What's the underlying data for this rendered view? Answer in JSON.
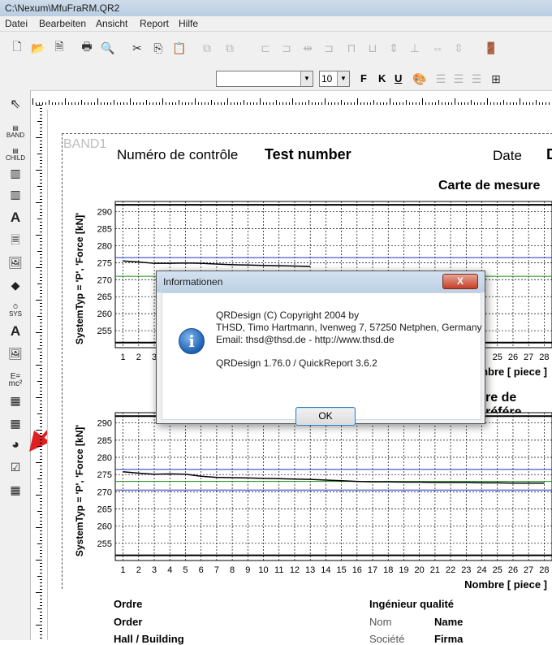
{
  "window": {
    "title": "C:\\Nexum\\MfuFraRM.QR2"
  },
  "menu": [
    "Datei",
    "Bearbeiten",
    "Ansicht",
    "Report",
    "Hilfe"
  ],
  "toolbar": {
    "font_value": "",
    "font_size": "10",
    "bold": "F",
    "italic": "K",
    "underline": "U"
  },
  "tools": [
    "BAND",
    "CHILD",
    "SYS"
  ],
  "report": {
    "band_label": "BAND1",
    "header": {
      "control_number_label": "Numéro de contrôle",
      "test_number": "Test number",
      "date_label": "Date",
      "d_label": "D"
    },
    "chart1": {
      "title": "Carte de mesure",
      "ylabel": "SystemTyp = 'P', 'Force [kN]'",
      "xlabel": "Nombre [ piece ]"
    },
    "chart2": {
      "title": "re de référe",
      "ylabel": "SystemTyp = 'P', 'Force [kN]'",
      "xlabel": "Nombre [ piece ]"
    },
    "footer": {
      "ordre": "Ordre",
      "order": "Order",
      "hall": "Hall / Building",
      "engineer": "Ingénieur qualité",
      "nom": "Nom",
      "name": "Name",
      "societe": "Société",
      "firma": "Firma"
    }
  },
  "chart_data": [
    {
      "type": "line",
      "title": "Carte de mesure",
      "xlabel": "Nombre [ piece ]",
      "ylabel": "SystemTyp = 'P', 'Force [kN]'",
      "x_ticks": [
        1,
        2,
        3,
        25,
        26,
        27,
        28
      ],
      "y_ticks": [
        255,
        260,
        265,
        270,
        275,
        280,
        285,
        290
      ],
      "ylim": [
        250,
        293
      ],
      "series": [
        {
          "values_x": [
            1,
            2,
            3,
            4,
            5,
            6,
            7,
            8,
            9,
            10,
            11,
            12,
            13
          ],
          "values_y": [
            275.5,
            275.2,
            274.8,
            274.8,
            274.9,
            274.8,
            274.6,
            274.4,
            274.3,
            274.2,
            274.1,
            274.0,
            273.9
          ]
        }
      ],
      "reference_lines": [
        292,
        276.5,
        271
      ]
    },
    {
      "type": "line",
      "title": "re de référe",
      "xlabel": "Nombre [ piece ]",
      "ylabel": "SystemTyp = 'P', 'Force [kN]'",
      "x_ticks": [
        1,
        2,
        3,
        4,
        5,
        6,
        7,
        8,
        9,
        10,
        11,
        12,
        13,
        14,
        15,
        16,
        17,
        18,
        19,
        20,
        21,
        22,
        23,
        24,
        25,
        26,
        27,
        28
      ],
      "y_ticks": [
        255,
        260,
        265,
        270,
        275,
        280,
        285,
        290
      ],
      "ylim": [
        250,
        293
      ],
      "series": [
        {
          "values_x": [
            1,
            2,
            3,
            4,
            5,
            6,
            7,
            8,
            9,
            10,
            11,
            12,
            13,
            14,
            15,
            16,
            17,
            18,
            19,
            20,
            21,
            22,
            23,
            24,
            25,
            26,
            27,
            28
          ],
          "values_y": [
            275.8,
            275.4,
            275.1,
            275.2,
            275.1,
            274.5,
            274.2,
            274.1,
            274.0,
            273.9,
            273.8,
            273.7,
            273.6,
            273.4,
            273.2,
            273.0,
            272.9,
            272.9,
            272.8,
            272.8,
            272.7,
            272.7,
            272.7,
            272.6,
            272.6,
            272.5,
            272.5,
            272.5
          ]
        }
      ],
      "reference_lines": [
        292,
        276.5,
        273,
        270.5
      ]
    }
  ],
  "dialog": {
    "title": "Informationen",
    "line1": "QRDesign (C) Copyright 2004 by",
    "line2": "THSD, Timo Hartmann, Ivenweg 7, 57250 Netphen, Germany",
    "line3": "Email: thsd@thsd.de - http://www.thsd.de",
    "line4": "QRDesign 1.76.0 / QuickReport 3.6.2",
    "ok": "OK",
    "close": "X"
  }
}
